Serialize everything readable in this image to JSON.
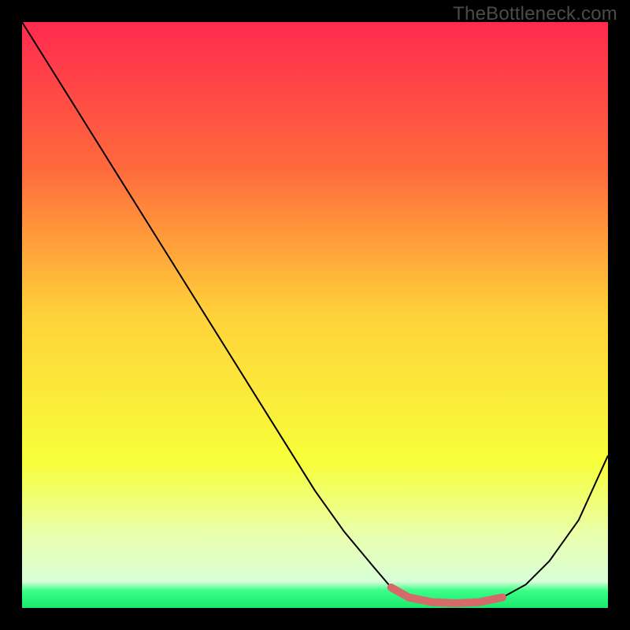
{
  "watermark": "TheBottleneck.com",
  "chart_data": {
    "type": "line",
    "title": "",
    "xlabel": "",
    "ylabel": "",
    "xlim": [
      0,
      100
    ],
    "ylim": [
      0,
      100
    ],
    "grid": false,
    "legend": false,
    "series": [
      {
        "name": "curve",
        "x": [
          0,
          5,
          10,
          15,
          20,
          25,
          30,
          35,
          40,
          45,
          50,
          55,
          60,
          63,
          66,
          70,
          74,
          78,
          82,
          86,
          90,
          95,
          100
        ],
        "y": [
          100,
          92,
          84,
          76,
          68,
          60,
          52,
          44,
          36,
          28,
          20,
          13,
          7,
          3.5,
          1.8,
          1.0,
          0.8,
          1.0,
          1.8,
          4,
          8,
          15,
          26
        ],
        "stroke": "#000000",
        "stroke_width": 2
      },
      {
        "name": "highlight",
        "x": [
          63,
          66,
          70,
          74,
          78,
          82
        ],
        "y": [
          3.5,
          1.8,
          1.0,
          0.8,
          1.0,
          1.8
        ],
        "stroke": "#d46a6a",
        "stroke_width": 10
      }
    ],
    "gradient_stops": [
      {
        "offset": 0.0,
        "color": "#ff2a4f"
      },
      {
        "offset": 0.25,
        "color": "#ff6a3c"
      },
      {
        "offset": 0.5,
        "color": "#ffd23a"
      },
      {
        "offset": 0.75,
        "color": "#f7ff3a"
      },
      {
        "offset": 0.88,
        "color": "#e8ffb0"
      },
      {
        "offset": 0.955,
        "color": "#d8ffd8"
      },
      {
        "offset": 0.97,
        "color": "#3dff88"
      },
      {
        "offset": 1.0,
        "color": "#19e86e"
      }
    ]
  }
}
